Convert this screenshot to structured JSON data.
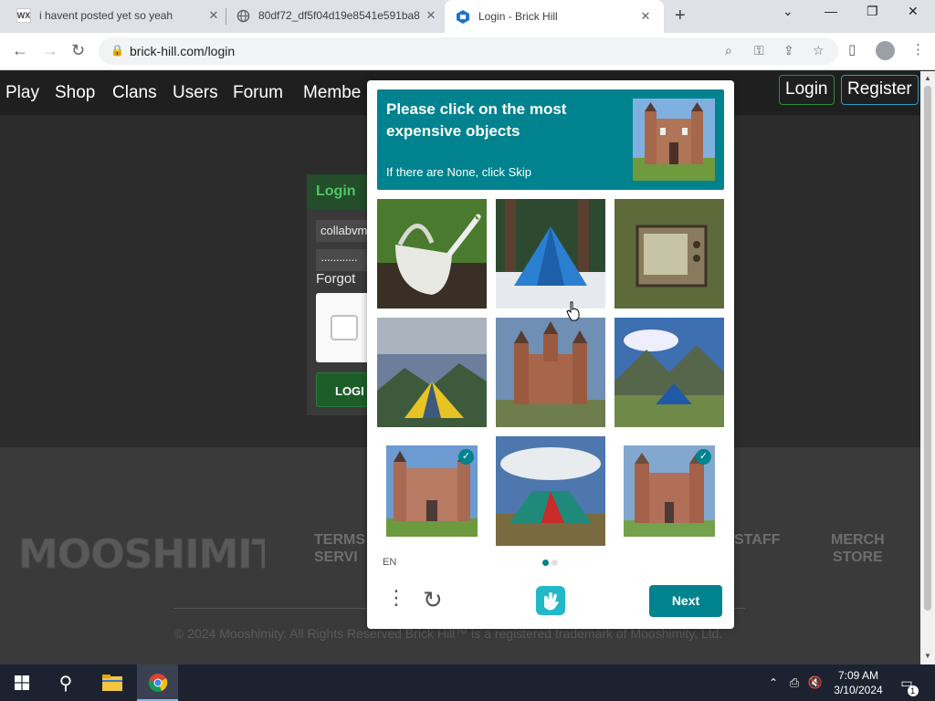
{
  "browser": {
    "tabs": [
      {
        "title": "i havent posted yet so yeah",
        "favicon": "wix-icon"
      },
      {
        "title": "80df72_df5f04d19e8541e591ba8",
        "favicon": "globe-icon"
      },
      {
        "title": "Login - Brick Hill",
        "favicon": "brickhill-icon"
      }
    ],
    "url": "brick-hill.com/login"
  },
  "site": {
    "nav": [
      "Play",
      "Shop",
      "Clans",
      "Users",
      "Forum",
      "Membe"
    ],
    "header_login": "Login",
    "header_register": "Register",
    "login_card": {
      "title": "Login",
      "username_value": "collabvm",
      "password_value": "············",
      "forgot": "Forgot",
      "submit": "LOGI"
    },
    "footer": {
      "logo": "MOOSHIMITY",
      "links": [
        "TERMS\nSERVI",
        "STAFF",
        "MERCH\nSTORE"
      ],
      "copyright": "© 2024 Mooshimity. All Rights Reserved Brick Hill™ is a registered trademark of Mooshimity, Ltd."
    }
  },
  "captcha": {
    "prompt": "Please click on the most expensive objects",
    "sub": "If there are None, click Skip",
    "tiles": [
      {
        "subject": "watering can",
        "selected": false
      },
      {
        "subject": "tent in forest",
        "selected": false
      },
      {
        "subject": "old television",
        "selected": false
      },
      {
        "subject": "tent by mountains",
        "selected": false
      },
      {
        "subject": "castle",
        "selected": false
      },
      {
        "subject": "tent on trail",
        "selected": false
      },
      {
        "subject": "castle",
        "selected": true
      },
      {
        "subject": "tent on field",
        "selected": false
      },
      {
        "subject": "castle",
        "selected": true
      }
    ],
    "lang": "EN",
    "next": "Next",
    "accent": "#00838f"
  },
  "taskbar": {
    "time": "7:09 AM",
    "date": "3/10/2024",
    "notifications": "1"
  }
}
